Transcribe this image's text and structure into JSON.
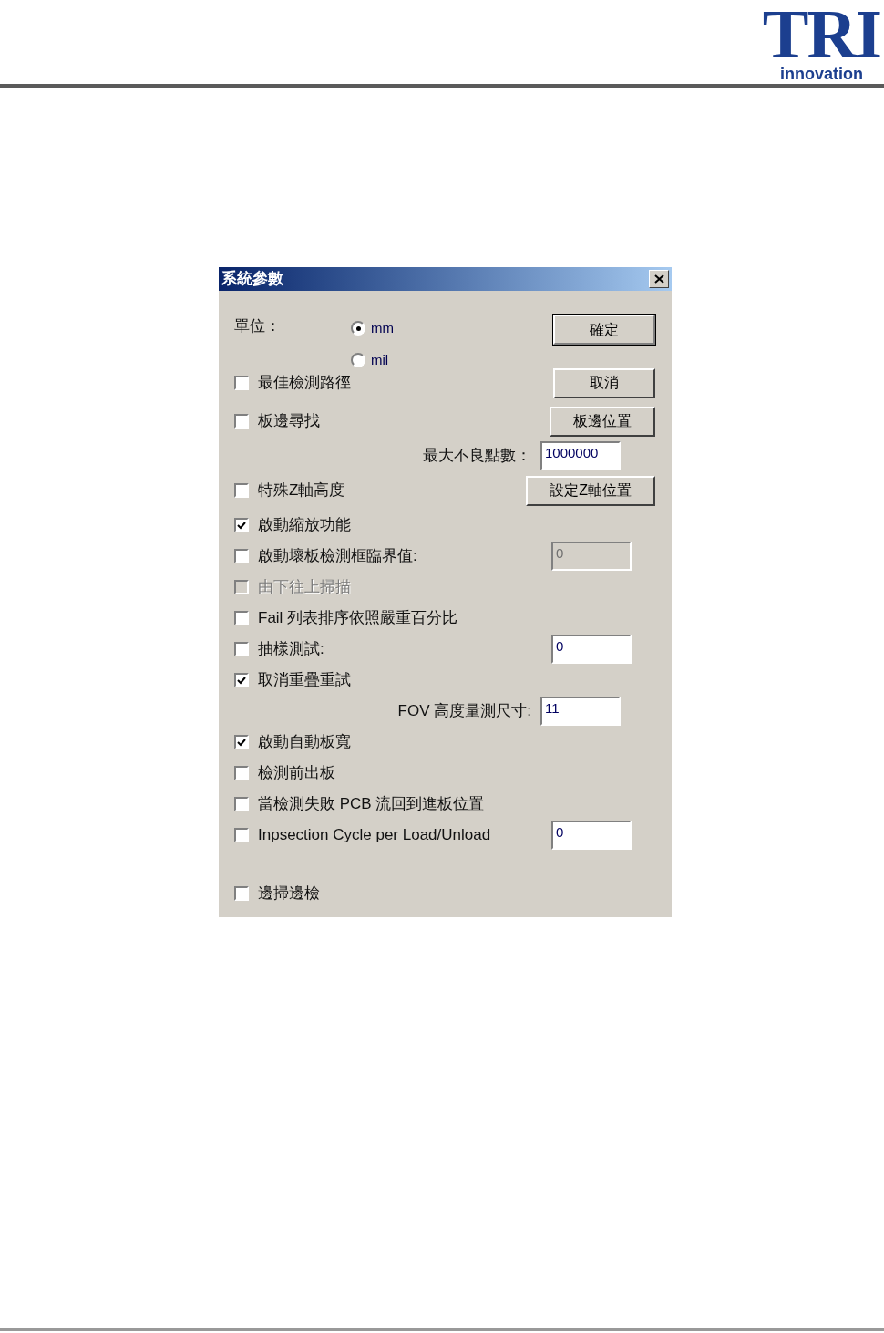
{
  "header": {
    "logo": {
      "mark": "TRI",
      "tagline": "innovation"
    }
  },
  "dialog": {
    "title": "系統參數",
    "units": {
      "label": "單位：",
      "options": [
        {
          "label": "mm",
          "selected": true
        },
        {
          "label": "mil",
          "selected": false
        }
      ],
      "button": {
        "label": "確定",
        "default": true
      }
    },
    "rows": [
      {
        "kind": "checkbox",
        "label": "最佳檢測路徑",
        "checked": false,
        "disabled": false,
        "action": {
          "kind": "button",
          "label": "取消",
          "default": false
        }
      },
      {
        "kind": "checkbox",
        "label": "板邊尋找",
        "checked": false,
        "disabled": false,
        "action": {
          "kind": "button",
          "label": "板邊位置",
          "default": false
        }
      },
      {
        "kind": "field",
        "label": "最大不良點數：",
        "action": {
          "kind": "field",
          "value": "1000000",
          "disabled": false
        }
      },
      {
        "kind": "checkbox",
        "label": "特殊Z軸高度",
        "checked": false,
        "disabled": false,
        "action": {
          "kind": "button",
          "label": "設定Z軸位置",
          "default": false
        }
      },
      {
        "kind": "checkbox",
        "label": "啟動縮放功能",
        "checked": true,
        "disabled": false
      },
      {
        "kind": "checkbox",
        "label": "啟動壞板檢測框臨界值:",
        "checked": false,
        "disabled": false,
        "action": {
          "kind": "field",
          "value": "0",
          "disabled": true
        }
      },
      {
        "kind": "checkbox",
        "label": "由下往上掃描",
        "checked": false,
        "disabled": true
      },
      {
        "kind": "checkbox",
        "label": "Fail 列表排序依照嚴重百分比",
        "checked": false,
        "disabled": false
      },
      {
        "kind": "checkbox",
        "label": "抽樣測試:",
        "checked": false,
        "disabled": false,
        "action": {
          "kind": "field",
          "value": "0",
          "disabled": false
        }
      },
      {
        "kind": "checkbox",
        "label": "取消重疊重試",
        "checked": true,
        "disabled": false
      },
      {
        "kind": "field",
        "label": "FOV 高度量測尺寸:",
        "action": {
          "kind": "field",
          "value": "11",
          "disabled": false
        }
      },
      {
        "kind": "checkbox",
        "label": "啟動自動板寬",
        "checked": true,
        "disabled": false
      },
      {
        "kind": "checkbox",
        "label": "檢測前出板",
        "checked": false,
        "disabled": false
      },
      {
        "kind": "checkbox",
        "label": "當檢測失敗 PCB 流回到進板位置",
        "checked": false,
        "disabled": false
      },
      {
        "kind": "checkbox",
        "label": "Inpsection Cycle per Load/Unload",
        "checked": false,
        "disabled": false,
        "action": {
          "kind": "field",
          "value": "0",
          "disabled": false
        }
      },
      {
        "kind": "checkbox",
        "label": "邊掃邊檢",
        "checked": false,
        "disabled": false
      }
    ]
  }
}
